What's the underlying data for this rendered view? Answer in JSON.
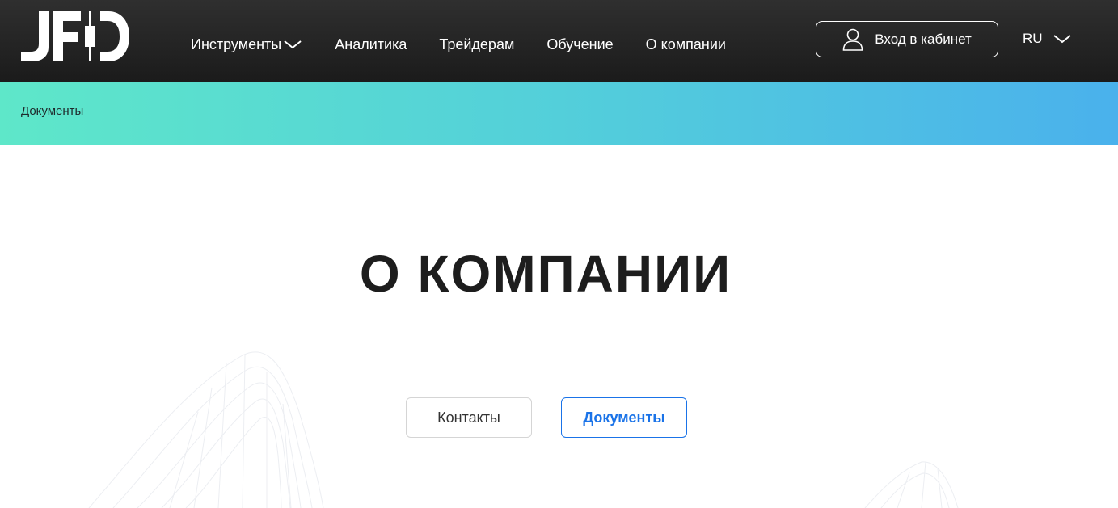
{
  "brand": {
    "logo_text": "JFD",
    "logo_icon": "candlestick-logo"
  },
  "header": {
    "nav": [
      {
        "label": "Инструменты",
        "has_dropdown": true
      },
      {
        "label": "Аналитика"
      },
      {
        "label": "Трейдерам"
      },
      {
        "label": "Обучение"
      },
      {
        "label": "О компании"
      }
    ],
    "login_label": "Вход в кабинет",
    "login_icon": "user-icon",
    "language": "RU"
  },
  "breadcrumb": {
    "current": "Документы"
  },
  "main": {
    "title": "О КОМПАНИИ",
    "tabs": [
      {
        "label": "Контакты",
        "active": false
      },
      {
        "label": "Документы",
        "active": true
      }
    ]
  },
  "colors": {
    "header_bg": "#1f1f1f",
    "band_start": "#5ee7c9",
    "band_end": "#4ab1ec",
    "accent": "#1a73e8"
  }
}
